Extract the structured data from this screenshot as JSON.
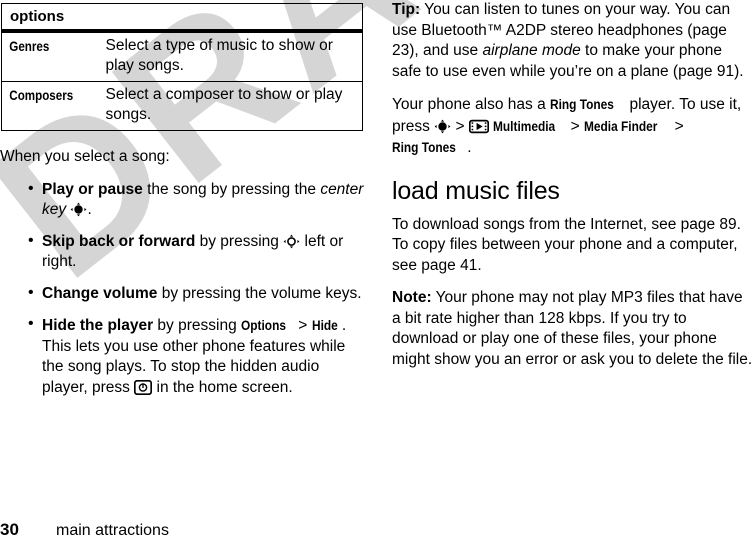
{
  "watermark": {
    "text": "DRAFT",
    "color": "#d5d5d5"
  },
  "options_table": {
    "header": "options",
    "rows": [
      {
        "key": "Genres",
        "description": "Select a type of music to show or play songs."
      },
      {
        "key": "Composers",
        "description": "Select a composer to show or play songs."
      }
    ]
  },
  "left_column": {
    "intro": "When you select a song:",
    "bullets": [
      {
        "lead": "Play or pause",
        "text_a": " the song by pressing the ",
        "italic": "center key",
        "icon": "center-key-icon",
        "text_b": "."
      },
      {
        "lead": "Skip back or forward",
        "text_a": " by pressing ",
        "icon": "nav-key-icon",
        "text_b": " left or right."
      },
      {
        "lead": "Change volume",
        "text_a": " by pressing the volume keys.",
        "text_b": ""
      },
      {
        "lead": "Hide the player",
        "text_a": " by pressing ",
        "menu_1": "Options",
        "gt_1": " > ",
        "menu_2": "Hide",
        "text_b": ". This lets you use other phone features while the song plays. To stop the hidden audio player, press ",
        "icon": "power-key-icon",
        "text_c": " in the home screen."
      }
    ]
  },
  "right_column": {
    "tip": {
      "label": "Tip:",
      "text_a": " You can listen to tunes on your way. You can use Bluetooth™ A2DP stereo headphones (page 23), and use ",
      "italic": "airplane mode",
      "text_b": " to make your phone safe to use even while you’re on a plane (page 91)."
    },
    "ringtones_para": {
      "text_a": "Your phone also has a ",
      "menu_1": "Ring Tones",
      "text_b": " player. To use it, press ",
      "icon_center": "center-key-icon",
      "gt_1": " > ",
      "icon_multimedia": "multimedia-icon",
      "menu_2": "Multimedia",
      "gt_2": " > ",
      "menu_3": "Media Finder",
      "gt_3": " > ",
      "menu_4": "Ring Tones",
      "text_c": "."
    },
    "section_heading": "load music files",
    "download_para": "To download songs from the Internet, see page 89. To copy files between your phone and a computer, see page 41.",
    "note": {
      "label": "Note:",
      "text": " Your phone may not play MP3 files that have a bit rate higher than 128 kbps. If you try to download or play one of these files, your phone might show you an error or ask you to delete the file."
    }
  },
  "footer": {
    "page_number": "30",
    "chapter_title": "main attractions"
  }
}
